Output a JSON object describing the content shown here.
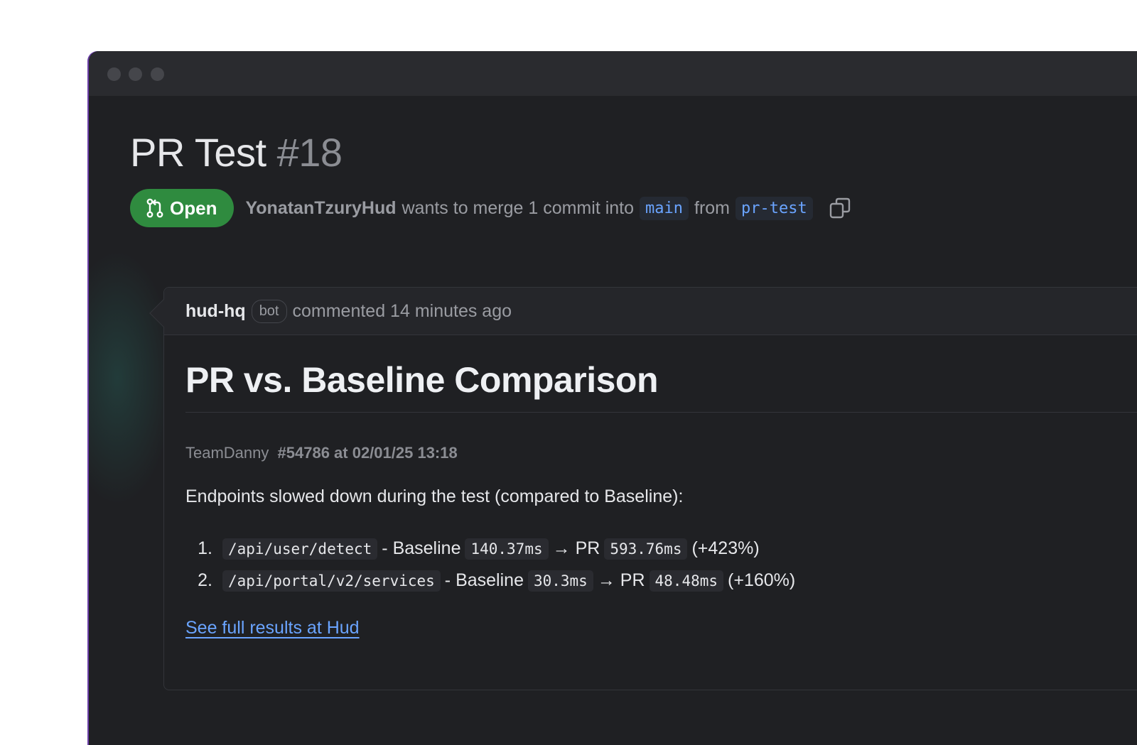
{
  "pr": {
    "title": "PR Test",
    "number": "#18",
    "status": "Open",
    "author": "YonatanTzuryHud",
    "merge_text": "wants to merge 1 commit into",
    "base_branch": "main",
    "from_text": "from",
    "head_branch": "pr-test"
  },
  "comment": {
    "user": "hud-hq",
    "badge": "bot",
    "action": "commented 14 minutes ago",
    "heading": "PR vs. Baseline Comparison",
    "team": "TeamDanny",
    "run": "#54786 at 02/01/25 13:18",
    "intro": "Endpoints slowed down during the test (compared to Baseline):",
    "endpoints": [
      {
        "index": "1.",
        "path": "/api/user/detect",
        "baseline_label": "- Baseline",
        "baseline": "140.37ms",
        "pr_label": "→ PR",
        "pr": "593.76ms",
        "delta": "(+423%)"
      },
      {
        "index": "2.",
        "path": "/api/portal/v2/services",
        "baseline_label": "- Baseline",
        "baseline": "30.3ms",
        "pr_label": "→ PR",
        "pr": "48.48ms",
        "delta": "(+160%)"
      }
    ],
    "link": "See full results at Hud"
  },
  "colors": {
    "open_badge": "#2f8b3f",
    "link": "#6aa4ff",
    "background": "#1f2023"
  },
  "icons": [
    "git-pull-request-icon",
    "copy-icon"
  ]
}
